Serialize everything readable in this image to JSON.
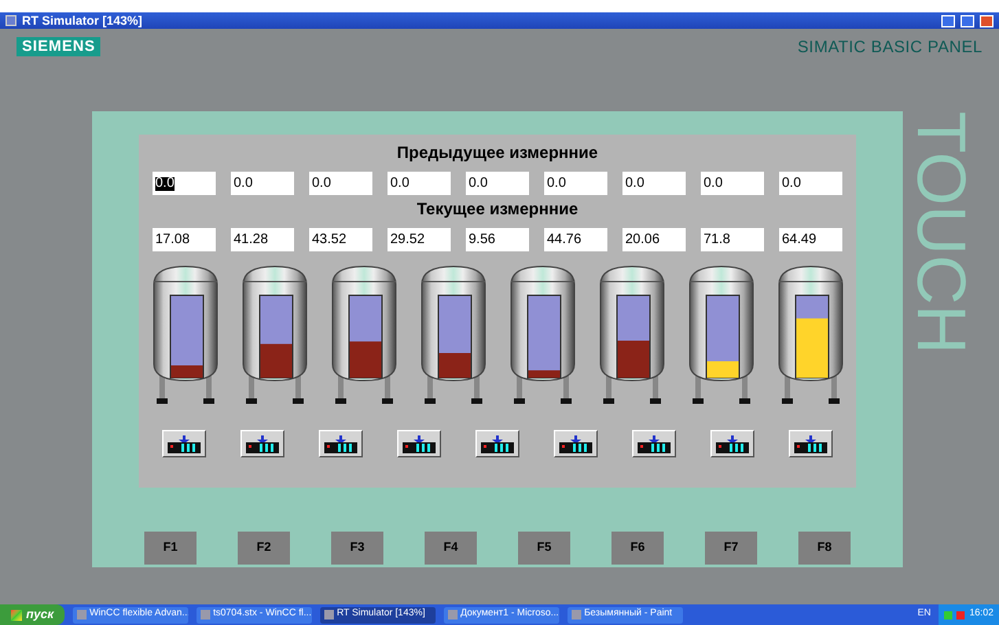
{
  "window": {
    "title": "RT Simulator [143%]"
  },
  "panel": {
    "brand": "SIEMENS",
    "model": "SIMATIC BASIC PANEL",
    "touch_label": "TOUCH"
  },
  "previous": {
    "heading": "Предыдущее измернние",
    "fields": [
      {
        "value": "0.0",
        "selected": true
      },
      {
        "value": "0.0",
        "selected": false
      },
      {
        "value": "0.0",
        "selected": false
      },
      {
        "value": "0.0",
        "selected": false
      },
      {
        "value": "0.0",
        "selected": false
      },
      {
        "value": "0.0",
        "selected": false
      },
      {
        "value": "0.0",
        "selected": false
      },
      {
        "value": "0.0",
        "selected": false
      },
      {
        "value": "0.0",
        "selected": false
      }
    ]
  },
  "current": {
    "heading": "Текущее измернние",
    "fields": [
      "17.08",
      "41.28",
      "43.52",
      "29.52",
      "9.56",
      "44.76",
      "20.06",
      "71.8",
      "64.49"
    ]
  },
  "tanks": [
    {
      "level": 0.15,
      "color": "#8b2318"
    },
    {
      "level": 0.41,
      "color": "#8b2318"
    },
    {
      "level": 0.44,
      "color": "#8b2318"
    },
    {
      "level": 0.3,
      "color": "#8b2318"
    },
    {
      "level": 0.09,
      "color": "#8b2318"
    },
    {
      "level": 0.45,
      "color": "#8b2318"
    },
    {
      "level": 0.2,
      "color": "#ffd42a"
    },
    {
      "level": 0.72,
      "color": "#ffd42a"
    }
  ],
  "panel_buttons": [
    {
      "kind": "keyboard"
    },
    {
      "kind": "keyboard"
    },
    {
      "kind": "keyboard"
    },
    {
      "kind": "keyboard"
    },
    {
      "kind": "keyboard"
    },
    {
      "kind": "keyboard"
    },
    {
      "kind": "keyboard"
    },
    {
      "kind": "keyboard"
    },
    {
      "kind": "keyboard"
    }
  ],
  "function_keys": [
    "F1",
    "F2",
    "F3",
    "F4",
    "F5",
    "F6",
    "F7",
    "F8"
  ],
  "taskbar": {
    "start": "пуск",
    "tasks": [
      {
        "label": "WinCC flexible Advan...",
        "selected": false
      },
      {
        "label": "ts0704.stx - WinCC fl...",
        "selected": false
      },
      {
        "label": "RT Simulator [143%]",
        "selected": true
      },
      {
        "label": "Документ1 - Microso...",
        "selected": false
      },
      {
        "label": "Безымянный - Paint",
        "selected": false
      }
    ],
    "lang": "EN",
    "time": "16:02"
  }
}
